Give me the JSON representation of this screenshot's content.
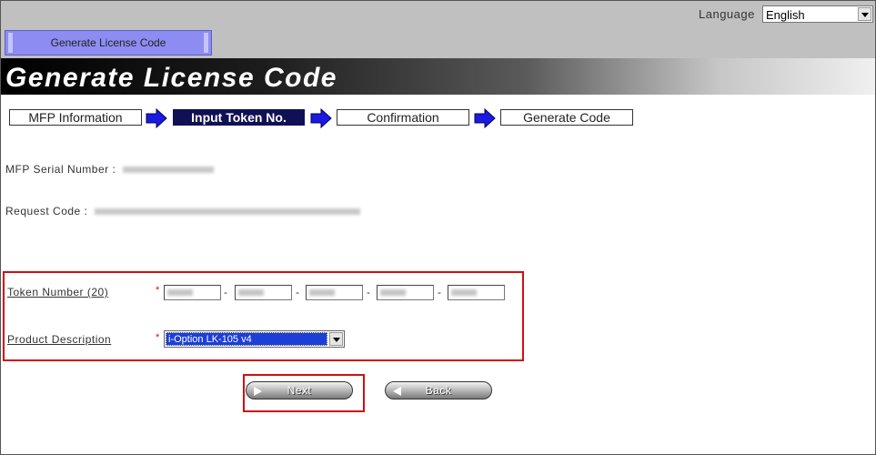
{
  "header": {
    "language_label": "Language",
    "language_value": "English",
    "menu_tab": "Generate License Code"
  },
  "page_title": "Generate License Code",
  "steps": [
    {
      "label": "MFP Information"
    },
    {
      "label": "Input Token No."
    },
    {
      "label": "Confirmation"
    },
    {
      "label": "Generate Code"
    }
  ],
  "active_step": "Input Token No.",
  "info": {
    "serial_label": "MFP Serial Number :",
    "request_label": "Request Code :"
  },
  "form": {
    "token_label": "Token Number (20)",
    "product_label": "Product Description",
    "required_mark": "*",
    "token_separator": "-",
    "product_value": "i-Option LK-105 v4"
  },
  "buttons": {
    "next": "Next",
    "back": "Back"
  },
  "colors": {
    "highlight_box": "#d01010",
    "active_step_bg": "#101054",
    "menu_tab_bg": "#8c8cf2",
    "selected_option_bg": "#1d3fd8"
  }
}
